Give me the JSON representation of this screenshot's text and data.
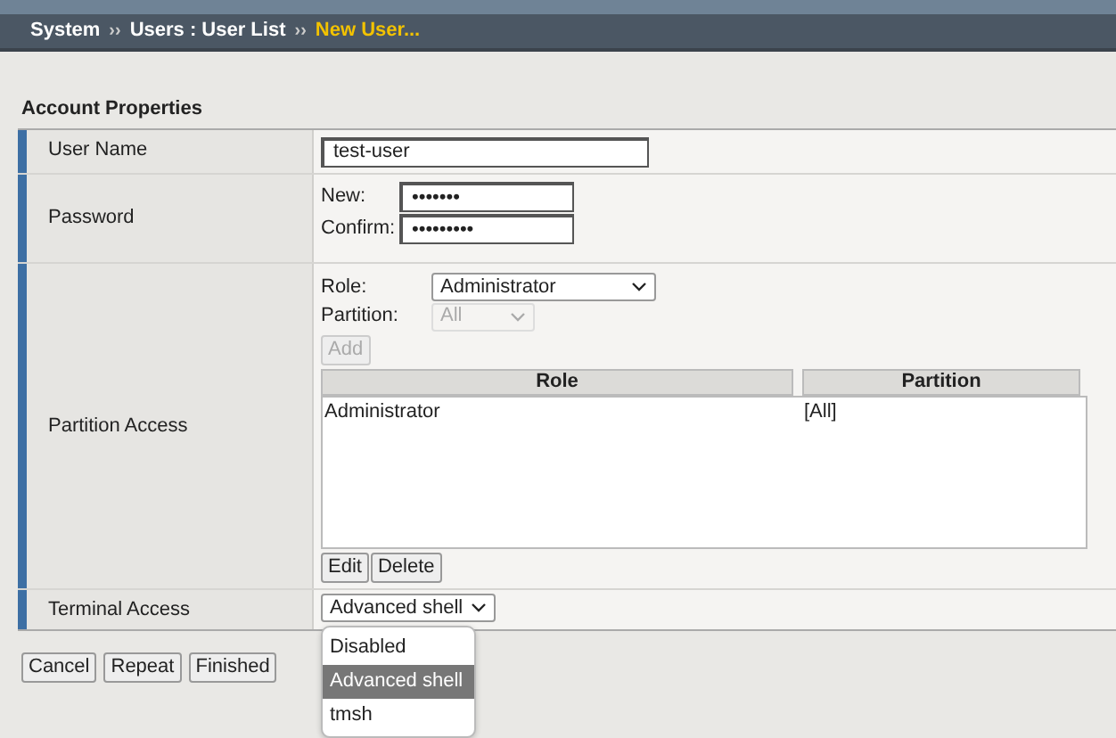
{
  "breadcrumb": [
    {
      "text": "System",
      "current": false
    },
    {
      "text": "Users : User List",
      "current": false
    },
    {
      "text": "New User...",
      "current": true
    }
  ],
  "breadcrumb_separator": "››",
  "section_title": "Account Properties",
  "user_name": {
    "label": "User Name",
    "value": "test-user"
  },
  "password": {
    "label": "Password",
    "new_label": "New:",
    "new_value": "•••••••",
    "confirm_label": "Confirm:",
    "confirm_value": "•••••••••"
  },
  "partition_access": {
    "label": "Partition Access",
    "role_label": "Role:",
    "role_value": "Administrator",
    "partition_label": "Partition:",
    "partition_value": "All",
    "partition_disabled": true,
    "add_button": "Add",
    "add_disabled": true,
    "columns": [
      "Role",
      "Partition"
    ],
    "rows": [
      {
        "role": "Administrator",
        "partition": "[All]"
      }
    ],
    "edit_button": "Edit",
    "delete_button": "Delete"
  },
  "terminal_access": {
    "label": "Terminal Access",
    "value": "Advanced shell",
    "expanded": true,
    "options": [
      {
        "label": "Disabled",
        "selected": false
      },
      {
        "label": "Advanced shell",
        "selected": true
      },
      {
        "label": "tmsh",
        "selected": false
      }
    ]
  },
  "buttons": [
    "Cancel",
    "Repeat",
    "Finished"
  ]
}
